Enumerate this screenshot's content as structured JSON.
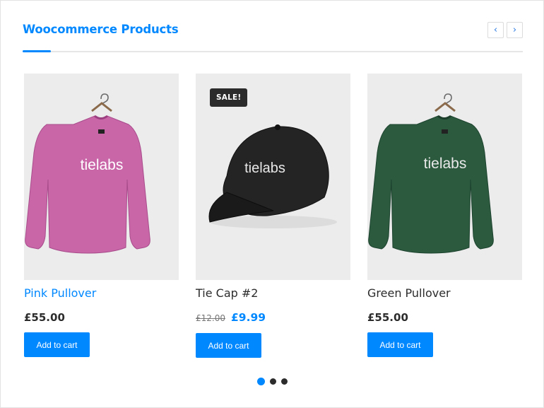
{
  "widget": {
    "title": "Woocommerce Products",
    "prev_icon": "‹",
    "next_icon": "›",
    "accent_color": "#0088ff"
  },
  "products": [
    {
      "name": "Pink Pullover",
      "price": "£55.00",
      "cart_label": "Add to cart",
      "image": "pink-sweater",
      "brand": "tielabs",
      "color": "#c866a8"
    },
    {
      "name": "Tie Cap #2",
      "badge": "SALE!",
      "price_old": "£12.00",
      "price_sale": "£9.99",
      "cart_label": "Add to cart",
      "image": "black-cap",
      "brand": "tielabs",
      "color": "#232323"
    },
    {
      "name": "Green Pullover",
      "price": "£55.00",
      "cart_label": "Add to cart",
      "image": "green-sweater",
      "brand": "tielabs",
      "color": "#2b5a3e"
    }
  ],
  "pagination": {
    "pages": 3,
    "active": 1
  }
}
